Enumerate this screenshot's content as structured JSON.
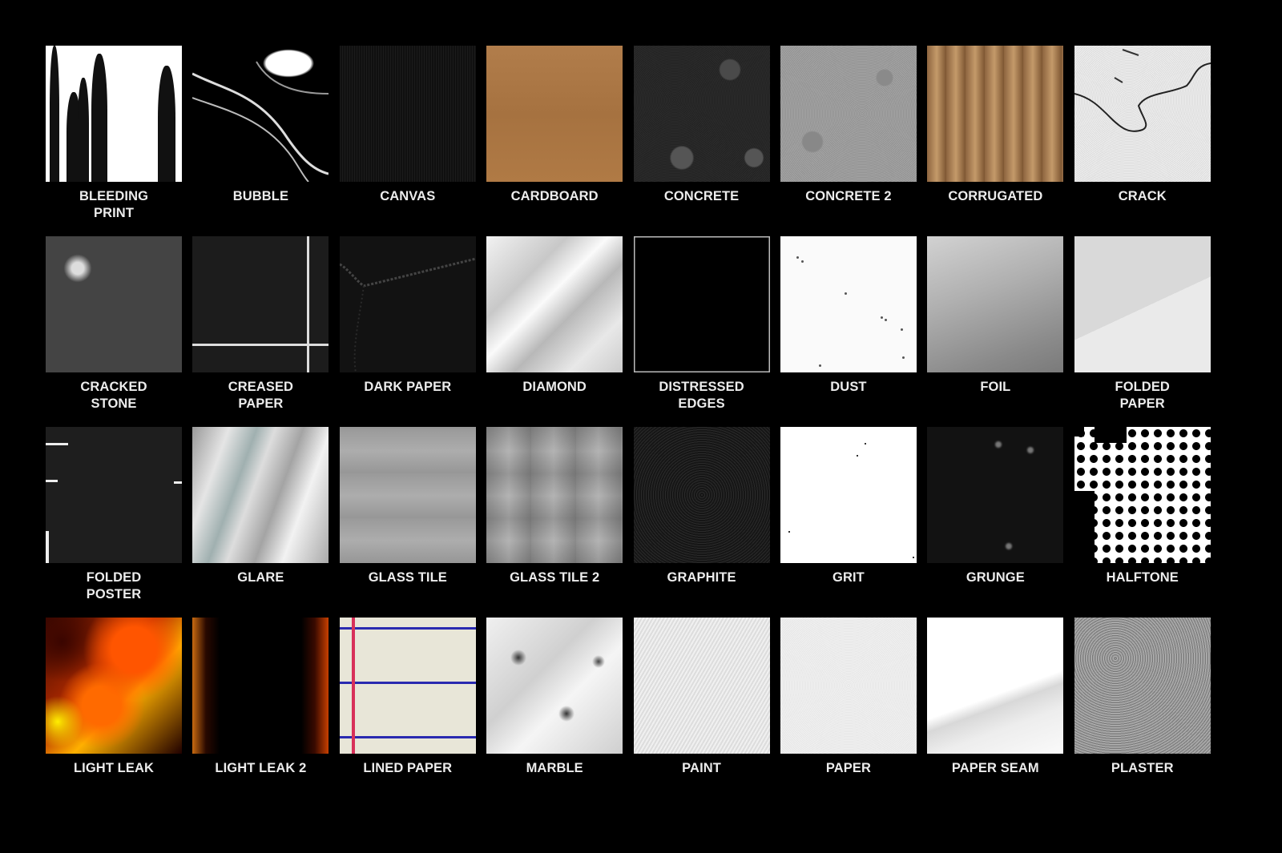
{
  "textures": [
    {
      "key": "bleeding-print",
      "label": "BLEEDING\nPRINT"
    },
    {
      "key": "bubble",
      "label": "BUBBLE"
    },
    {
      "key": "canvas",
      "label": "CANVAS"
    },
    {
      "key": "cardboard",
      "label": "CARDBOARD"
    },
    {
      "key": "concrete",
      "label": "CONCRETE"
    },
    {
      "key": "concrete-2",
      "label": "CONCRETE 2"
    },
    {
      "key": "corrugated",
      "label": "CORRUGATED"
    },
    {
      "key": "crack",
      "label": "CRACK"
    },
    {
      "key": "cracked-stone",
      "label": "CRACKED\nSTONE"
    },
    {
      "key": "creased-paper",
      "label": "CREASED\nPAPER"
    },
    {
      "key": "dark-paper",
      "label": "DARK PAPER"
    },
    {
      "key": "diamond",
      "label": "DIAMOND"
    },
    {
      "key": "distressed-edges",
      "label": "DISTRESSED\nEDGES"
    },
    {
      "key": "dust",
      "label": "DUST"
    },
    {
      "key": "foil",
      "label": "FOIL"
    },
    {
      "key": "folded-paper",
      "label": "FOLDED\nPAPER"
    },
    {
      "key": "folded-poster",
      "label": "FOLDED\nPOSTER"
    },
    {
      "key": "glare",
      "label": "GLARE"
    },
    {
      "key": "glass-tile",
      "label": "GLASS TILE"
    },
    {
      "key": "glass-tile-2",
      "label": "GLASS TILE 2"
    },
    {
      "key": "graphite",
      "label": "GRAPHITE"
    },
    {
      "key": "grit",
      "label": "GRIT"
    },
    {
      "key": "grunge",
      "label": "GRUNGE"
    },
    {
      "key": "halftone",
      "label": "HALFTONE"
    },
    {
      "key": "light-leak",
      "label": "LIGHT LEAK"
    },
    {
      "key": "light-leak-2",
      "label": "LIGHT LEAK 2"
    },
    {
      "key": "lined-paper",
      "label": "LINED PAPER"
    },
    {
      "key": "marble",
      "label": "MARBLE"
    },
    {
      "key": "paint",
      "label": "PAINT"
    },
    {
      "key": "paper",
      "label": "PAPER"
    },
    {
      "key": "paper-seam",
      "label": "PAPER SEAM"
    },
    {
      "key": "plaster",
      "label": "PLASTER"
    }
  ]
}
